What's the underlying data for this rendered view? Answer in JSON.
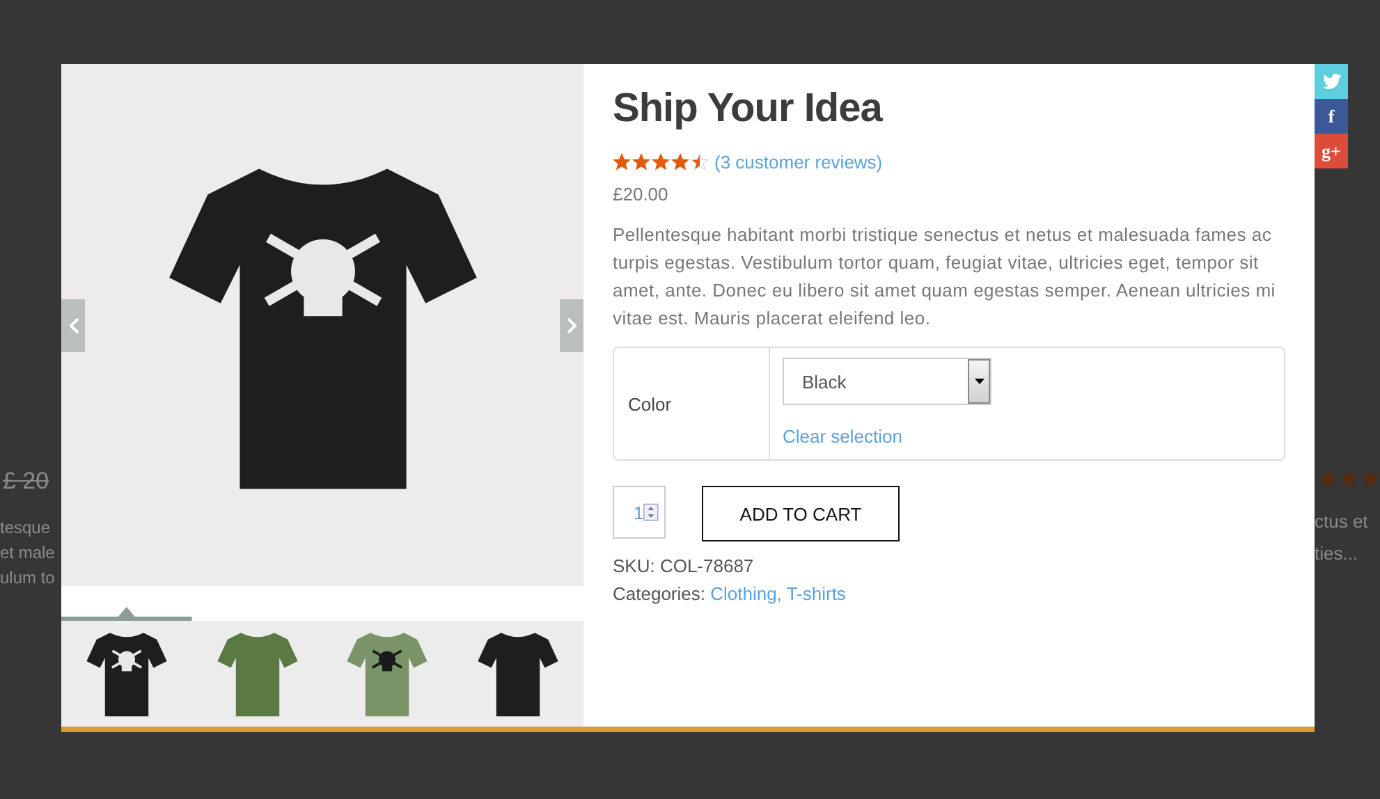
{
  "background": {
    "left": {
      "old_price": "£ 20",
      "text_lines": [
        "tesque",
        "et male",
        "ulum to"
      ]
    },
    "right": {
      "text_lines": [
        "ctus et",
        "ties..."
      ]
    }
  },
  "social": [
    {
      "kind": "twitter",
      "color": "#5fcfe0"
    },
    {
      "kind": "facebook",
      "color": "#3b5998",
      "glyph": "f"
    },
    {
      "kind": "google-plus",
      "color": "#dd4b39",
      "glyph": "g+"
    }
  ],
  "gallery": {
    "thumbnails": [
      {
        "color": "#1e1e1e",
        "kind": "skull-print",
        "selected": true
      },
      {
        "color": "#5b7a43",
        "kind": "plain",
        "selected": false
      },
      {
        "color": "#7a9468",
        "kind": "skull-print",
        "selected": false
      },
      {
        "color": "#1e1e1e",
        "kind": "plain",
        "selected": false
      }
    ]
  },
  "product": {
    "title": "Ship Your Idea",
    "stars": 4.5,
    "reviews_link": "(3 customer reviews)",
    "price": "£20.00",
    "description": "Pellentesque habitant morbi tristique senectus et netus et malesuada fames ac turpis egestas. Vestibulum tortor quam, feugiat vitae, ultricies eget, tempor sit amet, ante. Donec eu libero sit amet quam egestas semper. Aenean ultricies mi vitae est. Mauris placerat eleifend leo.",
    "variations": [
      {
        "label": "Color",
        "value": "Black"
      }
    ],
    "clear_link": "Clear selection",
    "quantity": "1",
    "add_to_cart_button": "ADD TO CART",
    "sku": "SKU: COL-78687",
    "categories": {
      "label": "Categories:",
      "links": [
        "Clothing,",
        "T-shirts"
      ]
    }
  }
}
